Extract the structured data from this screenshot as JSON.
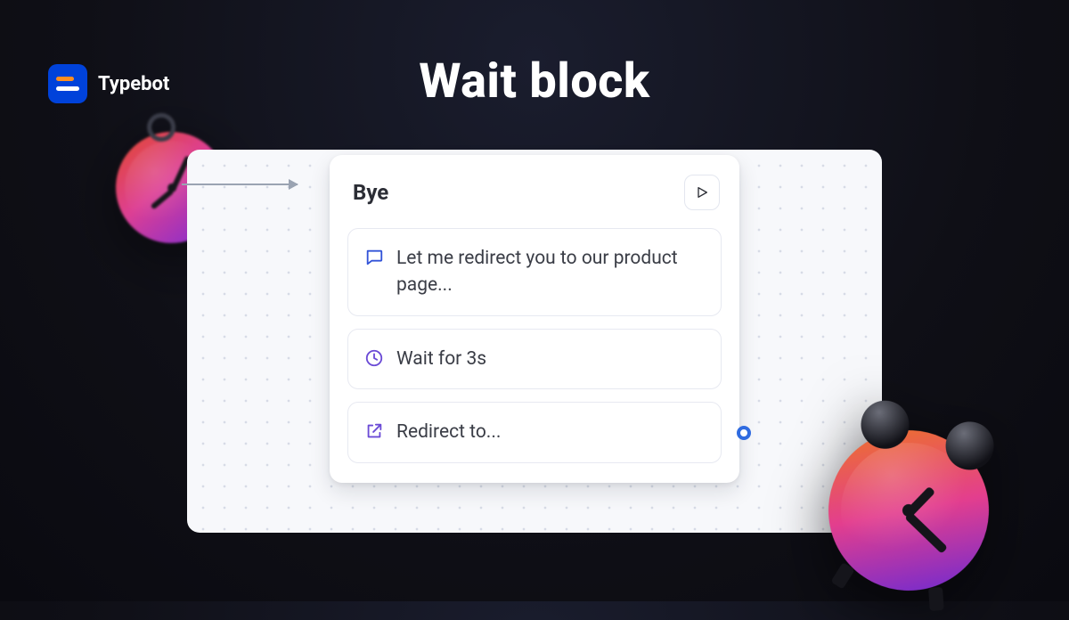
{
  "brand": {
    "name": "Typebot"
  },
  "page": {
    "title": "Wait block"
  },
  "block": {
    "title": "Bye",
    "steps": [
      {
        "icon": "chat",
        "label": "Let me redirect you to our product page..."
      },
      {
        "icon": "clock",
        "label": "Wait for 3s"
      },
      {
        "icon": "external",
        "label": "Redirect to..."
      }
    ]
  }
}
